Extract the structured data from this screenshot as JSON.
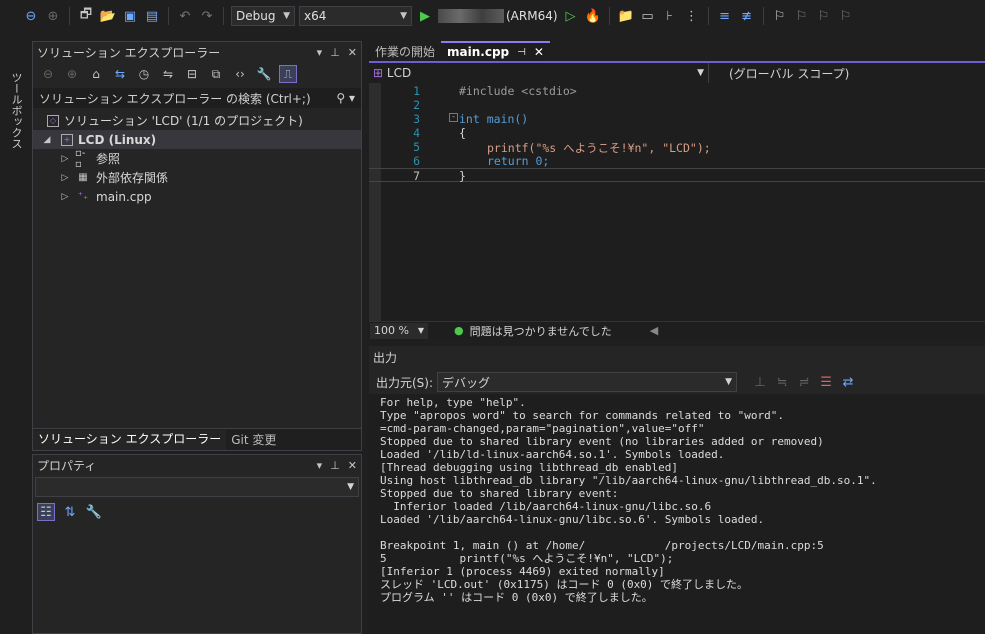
{
  "toolbar": {
    "config": "Debug",
    "platform": "x64",
    "run_target_suffix": "(ARM64)"
  },
  "vertical_tab": "ツールボックス",
  "solution_explorer": {
    "title": "ソリューション エクスプローラー",
    "search_label": "ソリューション エクスプローラー の検索 (Ctrl+;)",
    "tree": [
      {
        "label": "ソリューション 'LCD' (1/1 のプロジェクト)",
        "indent": 0
      },
      {
        "label": "LCD (Linux)",
        "indent": 1
      },
      {
        "label": "参照",
        "indent": 2
      },
      {
        "label": "外部依存関係",
        "indent": 2
      },
      {
        "label": "main.cpp",
        "indent": 2
      }
    ],
    "tabs": [
      "ソリューション エクスプローラー",
      "Git 変更"
    ]
  },
  "properties": {
    "title": "プロパティ"
  },
  "editor": {
    "tabs": [
      {
        "label": "作業の開始"
      },
      {
        "label": "main.cpp"
      }
    ],
    "project_dropdown": "LCD",
    "scope_dropdown": "(グローバル スコープ)",
    "lines": [
      {
        "n": "1",
        "text": "#include <cstdio>"
      },
      {
        "n": "2",
        "text": ""
      },
      {
        "n": "3",
        "text": "int main()"
      },
      {
        "n": "4",
        "text": "{"
      },
      {
        "n": "5",
        "text": "printf(\"%s へようこそ!¥n\", \"LCD\");"
      },
      {
        "n": "6",
        "text": "return 0;"
      },
      {
        "n": "7",
        "text": "}"
      }
    ],
    "zoom": "100 %",
    "status": "問題は見つかりませんでした"
  },
  "output": {
    "title": "出力",
    "source_label": "出力元(S):",
    "source_value": "デバッグ",
    "lines": [
      "For help, type \"help\".",
      "Type \"apropos word\" to search for commands related to \"word\".",
      "=cmd-param-changed,param=\"pagination\",value=\"off\"",
      "Stopped due to shared library event (no libraries added or removed)",
      "Loaded '/lib/ld-linux-aarch64.so.1'. Symbols loaded.",
      "[Thread debugging using libthread_db enabled]",
      "Using host libthread_db library \"/lib/aarch64-linux-gnu/libthread_db.so.1\".",
      "Stopped due to shared library event:",
      "  Inferior loaded /lib/aarch64-linux-gnu/libc.so.6",
      "Loaded '/lib/aarch64-linux-gnu/libc.so.6'. Symbols loaded.",
      "",
      "Breakpoint 1, main () at /home/            /projects/LCD/main.cpp:5",
      "5\t    printf(\"%s へようこそ!¥n\", \"LCD\");",
      "[Inferior 1 (process 4469) exited normally]",
      "スレッド 'LCD.out' (0x1175) はコード 0 (0x0) で終了しました。",
      "プログラム '' はコード 0 (0x0) で終了しました。"
    ]
  }
}
